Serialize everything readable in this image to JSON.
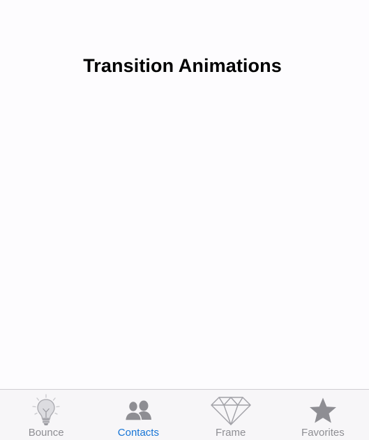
{
  "screen": {
    "title": "Transition Animations"
  },
  "tab_bar": {
    "active": "Contacts",
    "colors": {
      "active": "#1775d6",
      "inactive": "#8e8e93"
    },
    "tabs": [
      {
        "label": "Bounce",
        "icon": "lightbulb-icon"
      },
      {
        "label": "Contacts",
        "icon": "contacts-icon"
      },
      {
        "label": "Frame",
        "icon": "diamond-icon"
      },
      {
        "label": "Favorites",
        "icon": "star-icon"
      }
    ]
  }
}
